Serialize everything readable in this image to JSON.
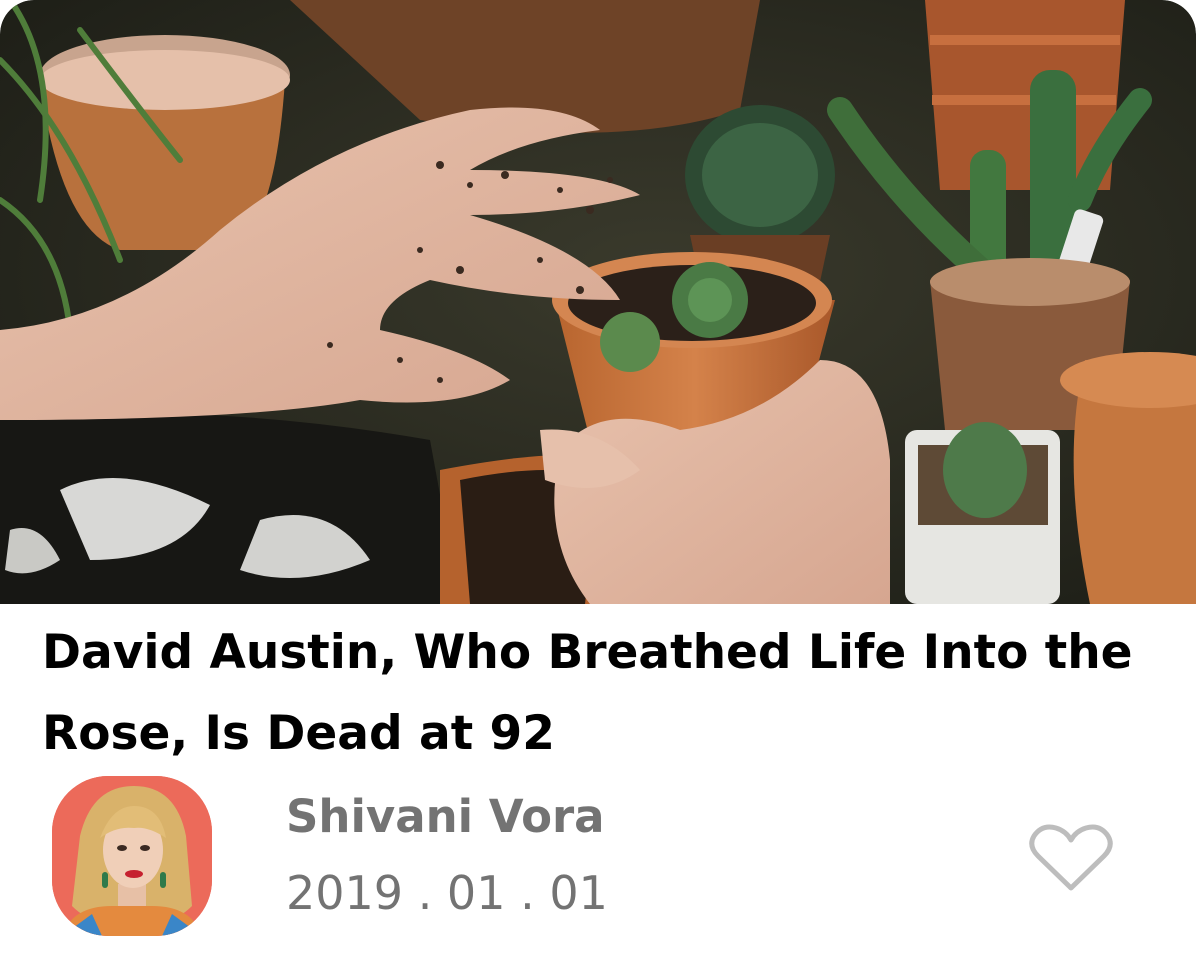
{
  "article": {
    "title": "David Austin, Who Breathed Life Into the Rose, Is Dead at 92",
    "author": "Shivani Vora",
    "date": "2019 . 01 . 01",
    "like_icon": "heart-outline-icon",
    "liked": false
  },
  "colors": {
    "title_text": "#000000",
    "meta_text": "#737373",
    "heart_outline": "#bdbdbd",
    "avatar_background": "#ec6a5a"
  }
}
